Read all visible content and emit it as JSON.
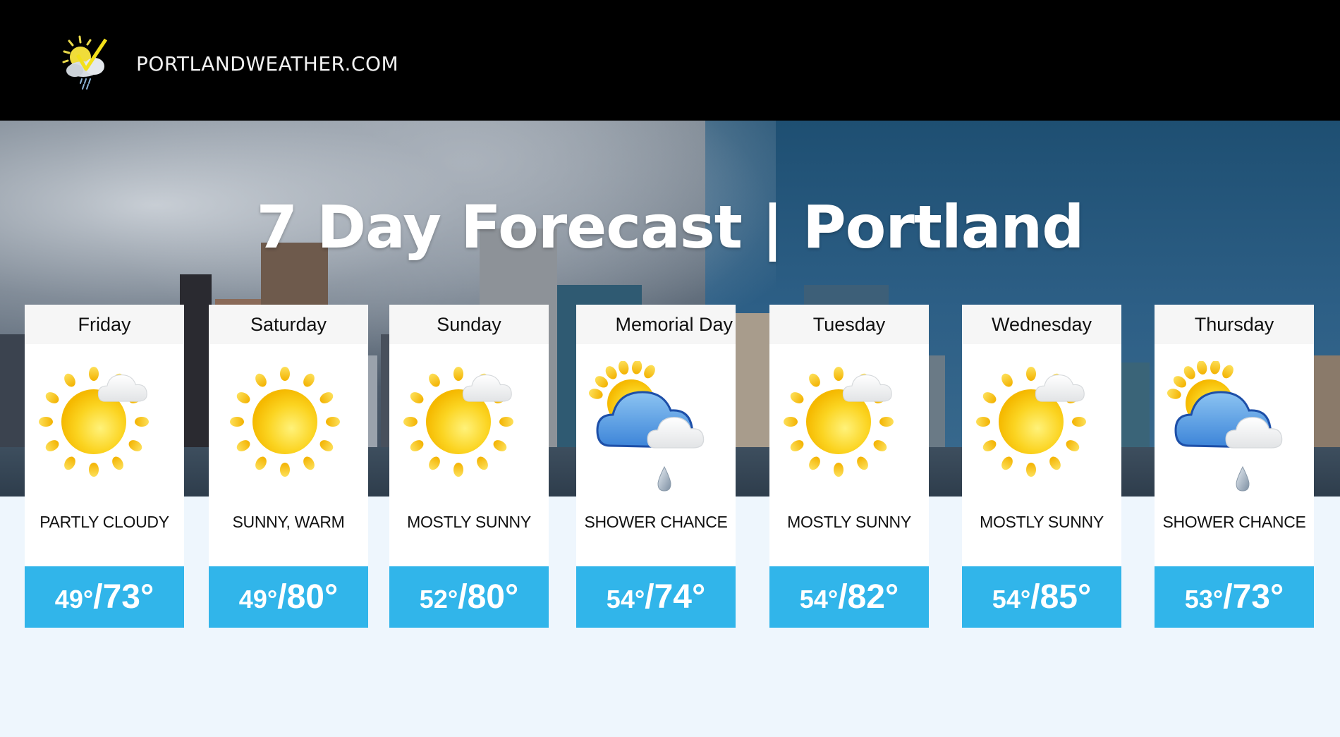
{
  "site": {
    "name": "PORTLANDWEATHER.COM",
    "logo_icon": "sun-cloud-check-icon"
  },
  "hero": {
    "title": "7 Day Forecast | Portland"
  },
  "colors": {
    "temp_band": "#31B5EA",
    "page_bg": "#EEF6FD",
    "header_bg": "#000000",
    "day_header_bg": "#F6F6F6"
  },
  "forecast": [
    {
      "day": "Friday",
      "icon": "partly-cloudy-icon",
      "condition": "PARTLY CLOUDY",
      "low": "49°",
      "high": "73°"
    },
    {
      "day": "Saturday",
      "icon": "sunny-icon",
      "condition": "SUNNY, WARM",
      "low": "49°",
      "high": "80°"
    },
    {
      "day": "Sunday",
      "icon": "partly-cloudy-icon",
      "condition": "MOSTLY SUNNY",
      "low": "52°",
      "high": "80°"
    },
    {
      "day": "Memorial Day",
      "icon": "shower-icon",
      "condition": "SHOWER CHANCE",
      "low": "54°",
      "high": "74°"
    },
    {
      "day": "Tuesday",
      "icon": "partly-cloudy-icon",
      "condition": "MOSTLY SUNNY",
      "low": "54°",
      "high": "82°"
    },
    {
      "day": "Wednesday",
      "icon": "partly-cloudy-icon",
      "condition": "MOSTLY SUNNY",
      "low": "54°",
      "high": "85°"
    },
    {
      "day": "Thursday",
      "icon": "shower-icon",
      "condition": "SHOWER CHANCE",
      "low": "53°",
      "high": "73°"
    }
  ]
}
